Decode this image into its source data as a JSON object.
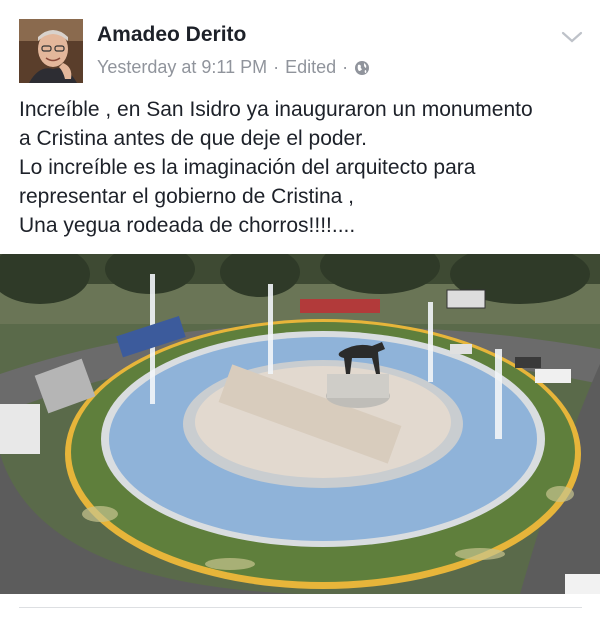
{
  "post": {
    "author": "Amadeo Derito",
    "timestamp": "Yesterday at 9:11 PM",
    "edited_label": "Edited",
    "separator": "·",
    "privacy_icon": "globe-icon",
    "menu_icon": "chevron-down-icon",
    "text_lines": [
      "Increíble , en San Isidro ya inauguraron un monumento",
      "a Cristina antes de que deje el poder.",
      "Lo increíble es la imaginación del arquitecto para",
      "representar el gobierno de Cristina ,",
      "Una yegua rodeada de chorros!!!!...."
    ]
  },
  "colors": {
    "author_text": "#1d2129",
    "meta_text": "#90949c",
    "water": "#8fb3d9",
    "grass": "#5f7f3c",
    "road": "#5a5a5a"
  }
}
